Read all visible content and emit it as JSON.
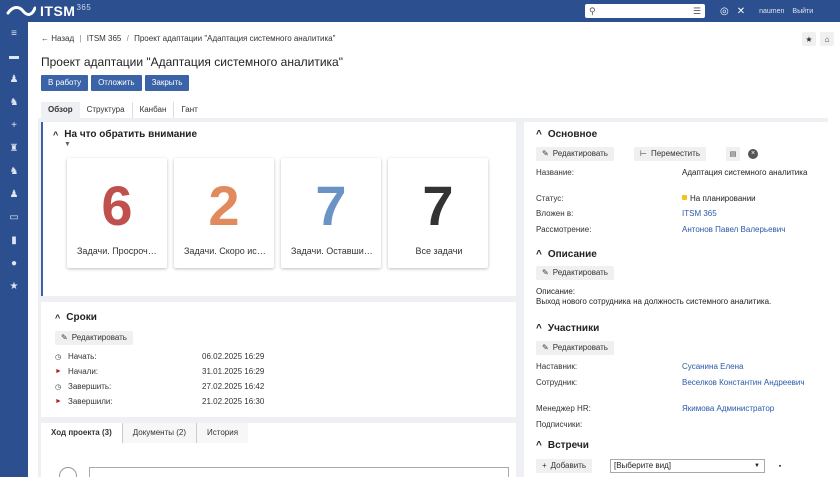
{
  "app": {
    "brand": "ITSM",
    "brand_sup": "365"
  },
  "topbar": {
    "user": "naumen",
    "logout": "Выйти"
  },
  "breadcrumb": {
    "back": "← Назад",
    "crumbs": [
      "ITSM 365",
      "Проект адаптации \"Адаптация системного аналитика\""
    ]
  },
  "page": {
    "title": "Проект адаптации \"Адаптация системного аналитика\"",
    "actions": [
      "В работу",
      "Отложить",
      "Закрыть"
    ],
    "tabs": [
      "Обзор",
      "Структура",
      "Канбан",
      "Гант"
    ]
  },
  "attention": {
    "title": "На что обратить внимание",
    "cards": [
      {
        "value": "6",
        "label": "Задачи. Просроченные",
        "color": "#c0504d"
      },
      {
        "value": "2",
        "label": "Задачи. Скоро истекают",
        "color": "#e08a5e"
      },
      {
        "value": "7",
        "label": "Задачи. Оставшиеся",
        "color": "#6b93c4"
      },
      {
        "value": "7",
        "label": "Все задачи",
        "color": "#333333"
      }
    ]
  },
  "deadlines": {
    "title": "Сроки",
    "edit": "Редактировать",
    "rows": [
      {
        "label": "Начать:",
        "value": "06.02.2025 16:29",
        "icon": "clock-icon"
      },
      {
        "label": "Начали:",
        "value": "31.01.2025 16:29",
        "icon": "flag-icon"
      },
      {
        "label": "Завершить:",
        "value": "27.02.2025 16:42",
        "icon": "clock-icon"
      },
      {
        "label": "Завершили:",
        "value": "21.02.2025 16:30",
        "icon": "flag-icon"
      }
    ]
  },
  "bottom_tabs": [
    "Ход проекта (3)",
    "Документы (2)",
    "История"
  ],
  "main_info": {
    "title": "Основное",
    "edit": "Редактировать",
    "move": "Переместить",
    "fields": [
      {
        "label": "Название:",
        "value": "Адаптация системного аналитика"
      },
      {
        "label": "Статус:",
        "value": "На планировании"
      },
      {
        "label": "Вложен в:",
        "value": "ITSM 365"
      },
      {
        "label": "Рассмотрение:",
        "value": "Антонов Павел Валерьевич"
      }
    ]
  },
  "description": {
    "title": "Описание",
    "edit": "Редактировать",
    "label": "Описание:",
    "text": "Выход нового сотрудника на должность системного аналитика."
  },
  "participants": {
    "title": "Участники",
    "edit": "Редактировать",
    "fields": [
      {
        "label": "Наставник:",
        "value": "Сусанина Елена"
      },
      {
        "label": "Сотрудник:",
        "value": "Веселков Константин Андреевич"
      },
      {
        "label": "Менеджер HR:",
        "value": "Якимова Администратор"
      },
      {
        "label": "Подписчики:",
        "value": ""
      }
    ]
  },
  "meetings": {
    "title": "Встречи",
    "add": "Добавить",
    "select_value": "[Выберите вид]"
  }
}
